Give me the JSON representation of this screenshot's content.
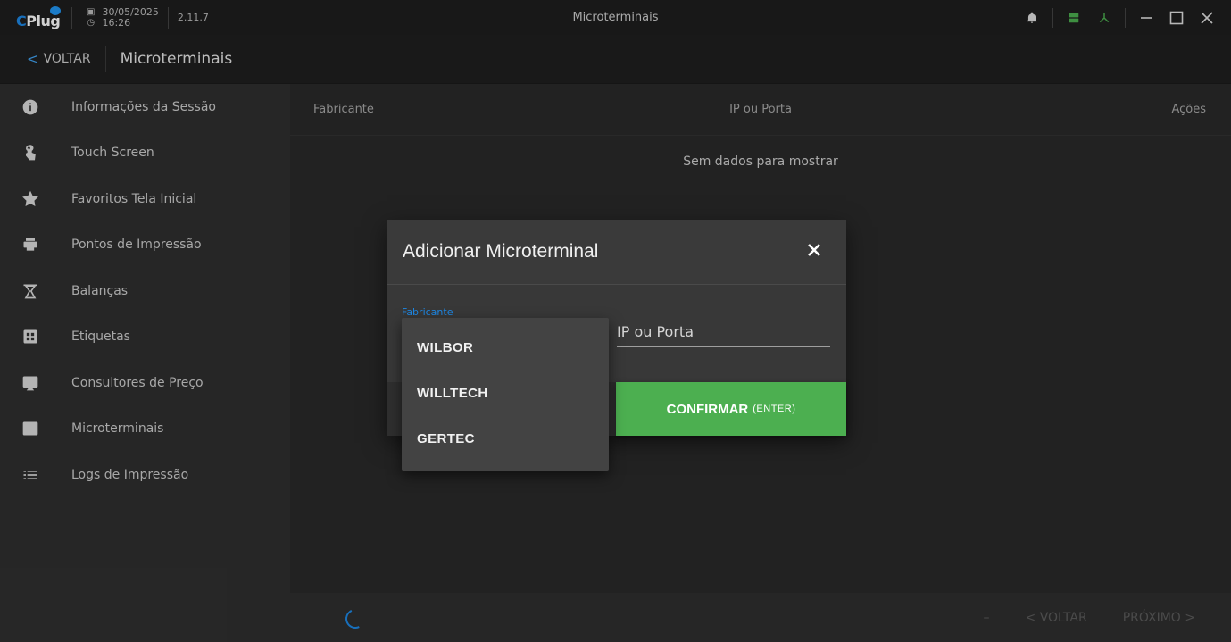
{
  "titlebar": {
    "logo": "CPlug",
    "date": "30/05/2025",
    "time": "16:26",
    "version": "2.11.7",
    "window_title": "Microterminais",
    "icons": [
      "bell-icon",
      "server-icon",
      "network-icon",
      "minimize-icon",
      "maximize-icon",
      "close-icon"
    ]
  },
  "subheader": {
    "back_label": "VOLTAR",
    "title": "Microterminais"
  },
  "sidebar": {
    "items": [
      {
        "label": "Informações da Sessão",
        "icon": "info-icon"
      },
      {
        "label": "Touch Screen",
        "icon": "touch-icon"
      },
      {
        "label": "Favoritos Tela Inicial",
        "icon": "star-icon"
      },
      {
        "label": "Pontos de Impressão",
        "icon": "printer-icon"
      },
      {
        "label": "Balanças",
        "icon": "scale-icon"
      },
      {
        "label": "Etiquetas",
        "icon": "label-icon"
      },
      {
        "label": "Consultores de Preço",
        "icon": "monitor-icon"
      },
      {
        "label": "Microterminais",
        "icon": "terminal-icon"
      },
      {
        "label": "Logs de Impressão",
        "icon": "list-icon"
      }
    ]
  },
  "table": {
    "columns": [
      "Fabricante",
      "IP ou Porta",
      "Ações"
    ],
    "empty_message": "Sem dados para mostrar"
  },
  "footer": {
    "dash": "–",
    "prev_label": "< VOLTAR",
    "next_label": "PRÓXIMO >"
  },
  "dialog": {
    "title": "Adicionar Microterminal",
    "fabricante_label": "Fabricante",
    "ip_label": "IP ou Porta",
    "confirm_label": "CONFIRMAR",
    "confirm_hint": "(ENTER)",
    "options": [
      "WILBOR",
      "WILLTECH",
      "GERTEC"
    ]
  },
  "colors": {
    "accent": "#1e88e5",
    "confirm": "#4caf50",
    "server": "#4caf50"
  }
}
